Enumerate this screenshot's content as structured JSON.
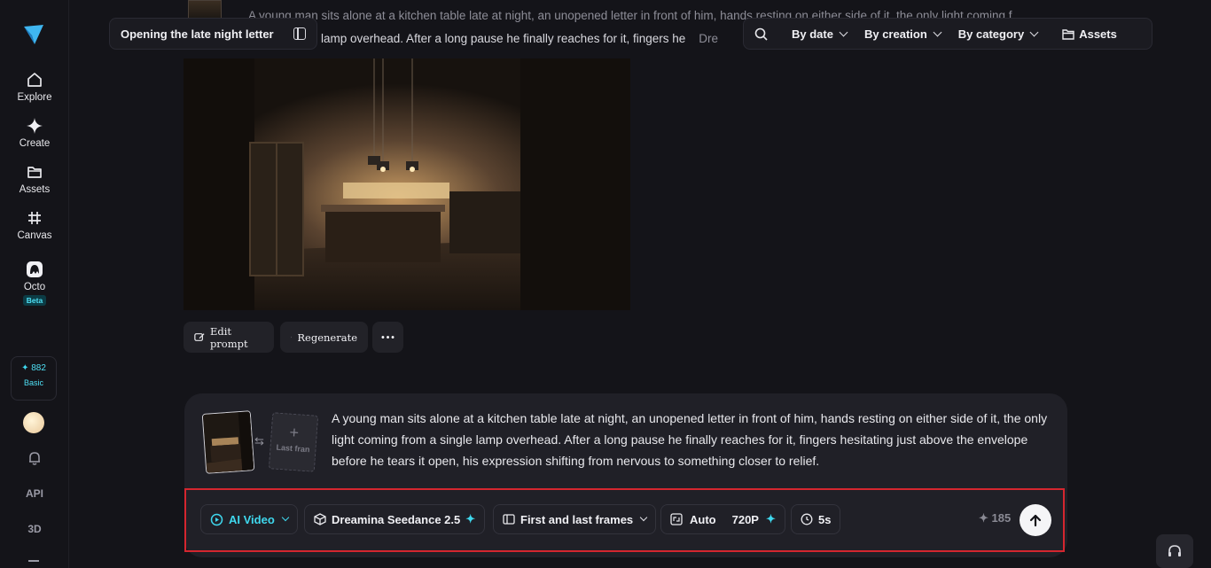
{
  "sidebar": {
    "items": [
      {
        "label": "Explore",
        "icon": "home-icon"
      },
      {
        "label": "Create",
        "icon": "sparkle-icon"
      },
      {
        "label": "Assets",
        "icon": "folder-icon"
      },
      {
        "label": "Canvas",
        "icon": "canvas-icon"
      },
      {
        "label": "Octo",
        "icon": "octo-icon",
        "badge": "Beta"
      }
    ],
    "credits": {
      "value": "882",
      "level": "Basic"
    },
    "api_label": "API",
    "three_d_label": "3D"
  },
  "header": {
    "title": "Opening the late night letter",
    "search_icon": "search-icon",
    "filters": [
      "By date",
      "By creation",
      "By category"
    ],
    "assets_label": "Assets"
  },
  "background_prompt": {
    "line1": "A young man sits alone at a kitchen table late at night, an unopened letter in front of him, hands resting on either side of it, the only light coming f",
    "line2": "lamp overhead. After a long pause he finally reaches for it, fingers he",
    "line2_tail": "Dre"
  },
  "actions": {
    "edit_prompt": "Edit prompt",
    "regenerate": "Regenerate"
  },
  "composer": {
    "last_frame_label": "Last fran",
    "prompt": "A young man sits alone at a kitchen table late at night, an unopened letter in front of him, hands resting on either side of it, the only light coming from a single lamp overhead. After a long pause he finally reaches for it, fingers hesitating just above the envelope before he tears it open, his expression shifting from nervous to something closer to relief.",
    "mode": "AI Video",
    "model": "Dreamina Seedance 2.5",
    "frames": "First and last frames",
    "ratio": "Auto",
    "resolution": "720P",
    "duration": "5s",
    "cost": "185"
  },
  "colors": {
    "accent": "#3fd8ee",
    "highlight": "#d4262f",
    "background": "#141419"
  }
}
